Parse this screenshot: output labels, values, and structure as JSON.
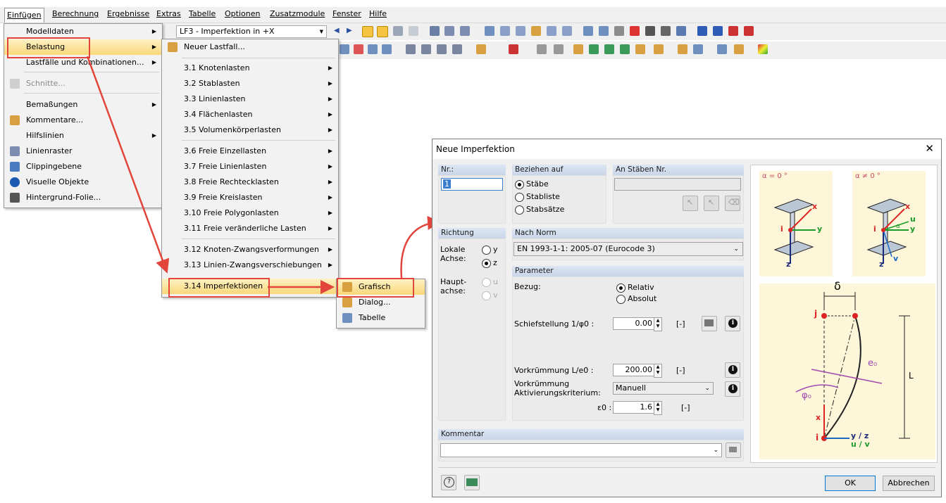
{
  "menubar": {
    "items": [
      "Einfügen",
      "Berechnung",
      "Ergebnisse",
      "Extras",
      "Tabelle",
      "Optionen",
      "Zusatzmodule",
      "Fenster",
      "Hilfe"
    ]
  },
  "toolbar": {
    "loadcase_combo": "LF3 - Imperfektion in +X"
  },
  "menu_einfuegen": {
    "items": [
      "Modelldaten",
      "Belastung",
      "Lastfälle und Kombinationen...",
      "Schnitte...",
      "Bemaßungen",
      "Kommentare...",
      "Hilfslinien",
      "Linienraster",
      "Clippingebene",
      "Visuelle Objekte",
      "Hintergrund-Folie..."
    ]
  },
  "menu_belastung": {
    "items": [
      "Neuer Lastfall...",
      "3.1 Knotenlasten",
      "3.2 Stablasten",
      "3.3 Linienlasten",
      "3.4 Flächenlasten",
      "3.5 Volumenkörperlasten",
      "3.6 Freie Einzellasten",
      "3.7 Freie Linienlasten",
      "3.8 Freie Rechtecklasten",
      "3.9 Freie Kreislasten",
      "3.10 Freie Polygonlasten",
      "3.11 Freie veränderliche Lasten",
      "3.12 Knoten-Zwangsverformungen",
      "3.13 Linien-Zwangsverschiebungen",
      "3.14 Imperfektionen"
    ]
  },
  "menu_imperfektionen": {
    "items": [
      "Grafisch",
      "Dialog...",
      "Tabelle"
    ]
  },
  "dialog": {
    "title": "Neue Imperfektion",
    "nr_header": "Nr.:",
    "nr_value": "1",
    "beziehen_header": "Beziehen auf",
    "beziehen_options": [
      "Stäbe",
      "Stabliste",
      "Stabsätze"
    ],
    "anstaeben_header": "An Stäben Nr.",
    "richtung_header": "Richtung",
    "lokale_label": "Lokale\nAchse:",
    "haupt_label": "Haupt-\nachse:",
    "axis_y": "y",
    "axis_z": "z",
    "axis_u": "u",
    "axis_v": "v",
    "norm_header": "Nach Norm",
    "norm_value": "EN 1993-1-1: 2005-07  (Eurocode 3)",
    "parameter_header": "Parameter",
    "bezug_label": "Bezug:",
    "bezug_options": [
      "Relativ",
      "Absolut"
    ],
    "schief_label": "Schiefstellung 1/φ0 :",
    "schief_value": "0.00",
    "unit_bracket": "[-]",
    "vork_label": "Vorkrümmung L/e0 :",
    "vork_value": "200.00",
    "akt_label": "Vorkrümmung\nAktivierungskriterium:",
    "akt_value": "Manuell",
    "eps_label": "ε0 :",
    "eps_value": "1.6",
    "kommentar_header": "Kommentar",
    "ok": "OK",
    "cancel": "Abbrechen"
  },
  "figure": {
    "alpha0": "α = 0 °",
    "alpha_ne0": "α ≠ 0 °",
    "x": "x",
    "y": "y",
    "z": "z",
    "u": "u",
    "v": "v",
    "i": "i",
    "j": "j",
    "alpha": "α",
    "delta": "δ",
    "e0": "e₀",
    "phi0": "φ₀",
    "L": "L",
    "yz": "y / z",
    "uv": "u / v"
  },
  "colors": {
    "annotation_red": "#e2453c",
    "menu_highlight": "#fad87a",
    "section_header": "#cad7e9"
  }
}
